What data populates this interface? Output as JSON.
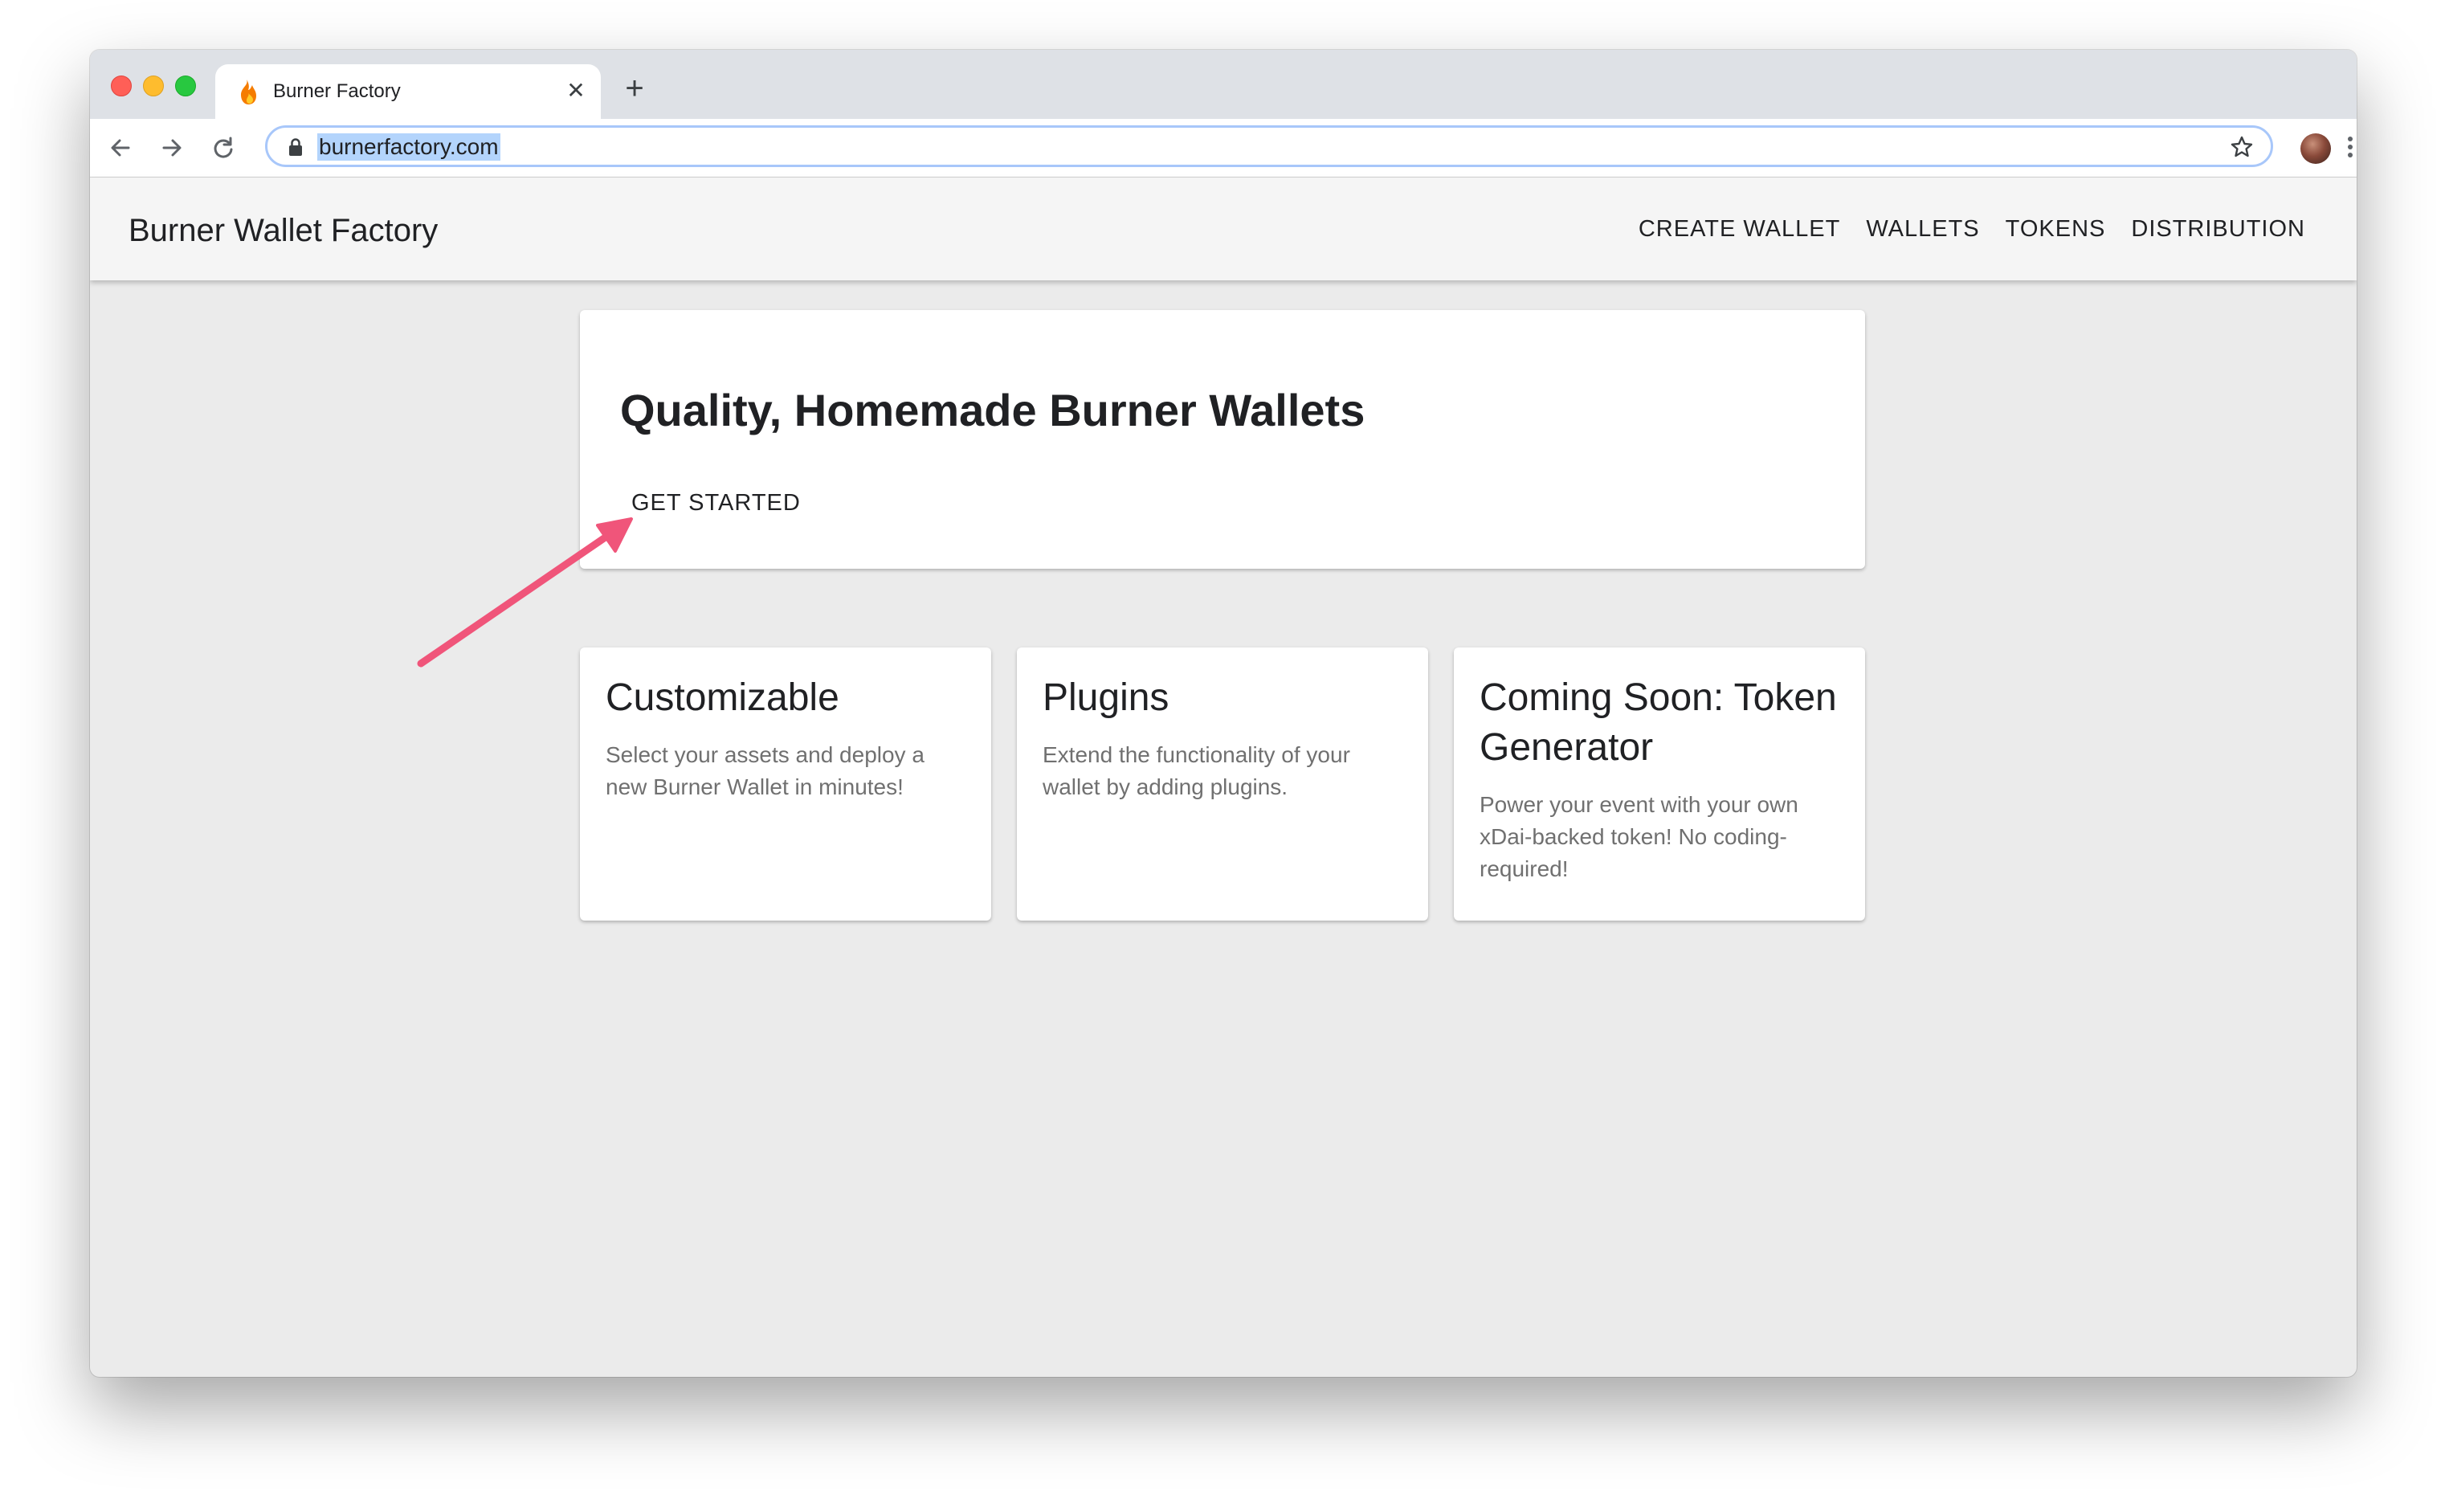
{
  "browser": {
    "tab_title": "Burner Factory",
    "url": "burnerfactory.com"
  },
  "app": {
    "brand": "Burner Wallet Factory",
    "nav": [
      "CREATE WALLET",
      "WALLETS",
      "TOKENS",
      "DISTRIBUTION"
    ]
  },
  "hero": {
    "title": "Quality, Homemade Burner Wallets",
    "cta_label": "GET STARTED"
  },
  "features": [
    {
      "title": "Customizable",
      "text": "Select your assets and deploy a new Burner Wallet in minutes!"
    },
    {
      "title": "Plugins",
      "text": "Extend the functionality of your wallet by adding plugins."
    },
    {
      "title": "Coming Soon: Token Generator",
      "text": "Power your event with your own xDai-backed token! No coding-required!"
    }
  ],
  "icons": {
    "favicon": "flame-icon",
    "back": "arrow-left-icon",
    "forward": "arrow-right-icon",
    "reload": "reload-icon",
    "lock": "lock-icon",
    "bookmark": "star-icon",
    "menu": "kebab-menu-icon",
    "annotation": "pointer-arrow-icon"
  },
  "colors": {
    "annotation_arrow": "#f0557a",
    "url_highlight": "#b3d4fc",
    "page_background": "#ebebeb"
  }
}
